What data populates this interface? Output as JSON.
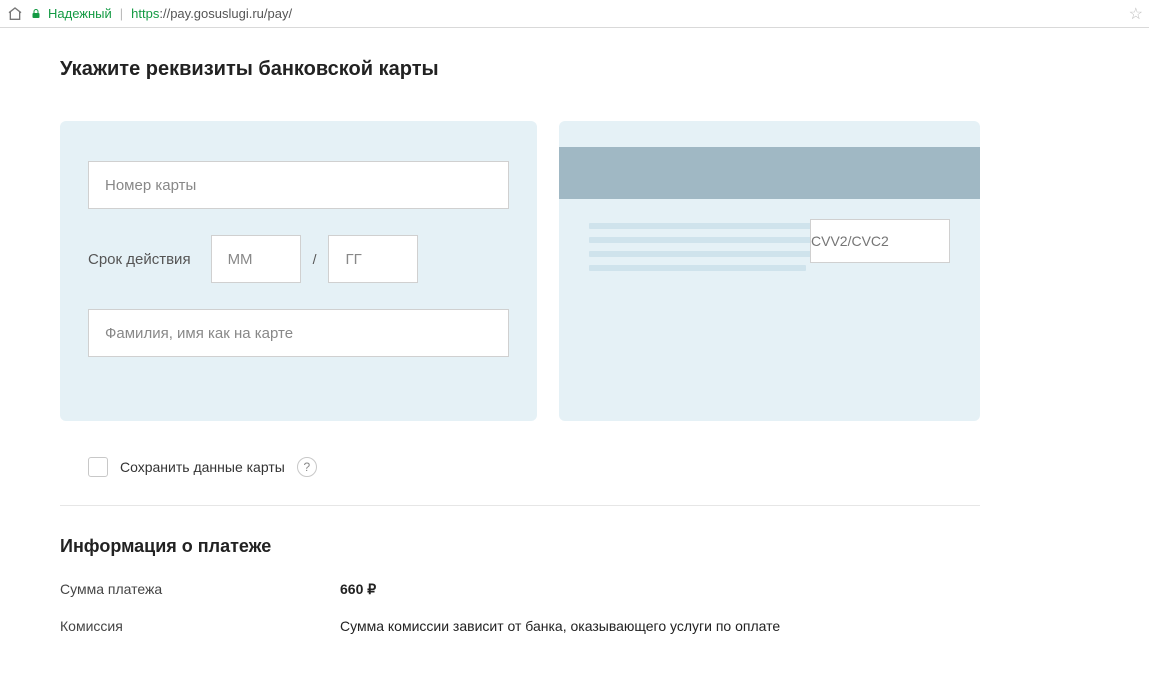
{
  "browser": {
    "secure_label": "Надежный",
    "url_scheme": "https",
    "url_rest": "://pay.gosuslugi.ru/pay/"
  },
  "form": {
    "heading": "Укажите реквизиты банковской карты",
    "card_number_placeholder": "Номер карты",
    "expiry_label": "Срок действия",
    "mm_placeholder": "ММ",
    "yy_placeholder": "ГГ",
    "slash": "/",
    "name_placeholder": "Фамилия, имя как на карте",
    "cvv_placeholder": "CVV2/CVC2",
    "save_card_label": "Сохранить данные карты",
    "help_symbol": "?"
  },
  "payment": {
    "heading": "Информация о платеже",
    "amount_label": "Сумма платежа",
    "amount_value": "660",
    "currency": "₽",
    "fee_label": "Комиссия",
    "fee_value": "Сумма комиссии зависит от банка, оказывающего услуги по оплате"
  }
}
